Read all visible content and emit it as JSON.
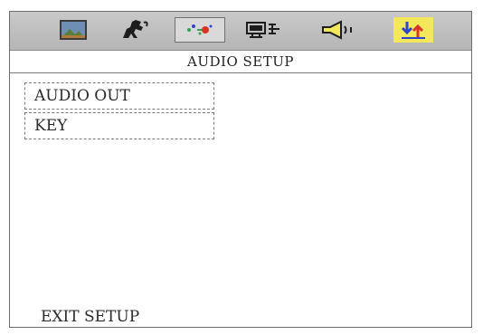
{
  "toolbar": {
    "icons": [
      {
        "name": "picture-icon",
        "active": false
      },
      {
        "name": "horse-icon",
        "active": false
      },
      {
        "name": "audio-settings-icon",
        "active": true
      },
      {
        "name": "display-icon",
        "active": false
      },
      {
        "name": "speaker-icon",
        "active": false
      },
      {
        "name": "exit-arrows-icon",
        "active": false
      }
    ]
  },
  "header": {
    "title": "AUDIO SETUP"
  },
  "menu": {
    "items": [
      {
        "label": "AUDIO OUT"
      },
      {
        "label": "KEY"
      }
    ]
  },
  "footer": {
    "exit_label": "EXIT SETUP"
  },
  "colors": {
    "toolbar_bg": "#c0c0c0",
    "highlight_bg": "#f2e85a",
    "accent_red": "#d9342a",
    "accent_blue": "#2f46c9",
    "accent_green": "#3aa14a"
  }
}
